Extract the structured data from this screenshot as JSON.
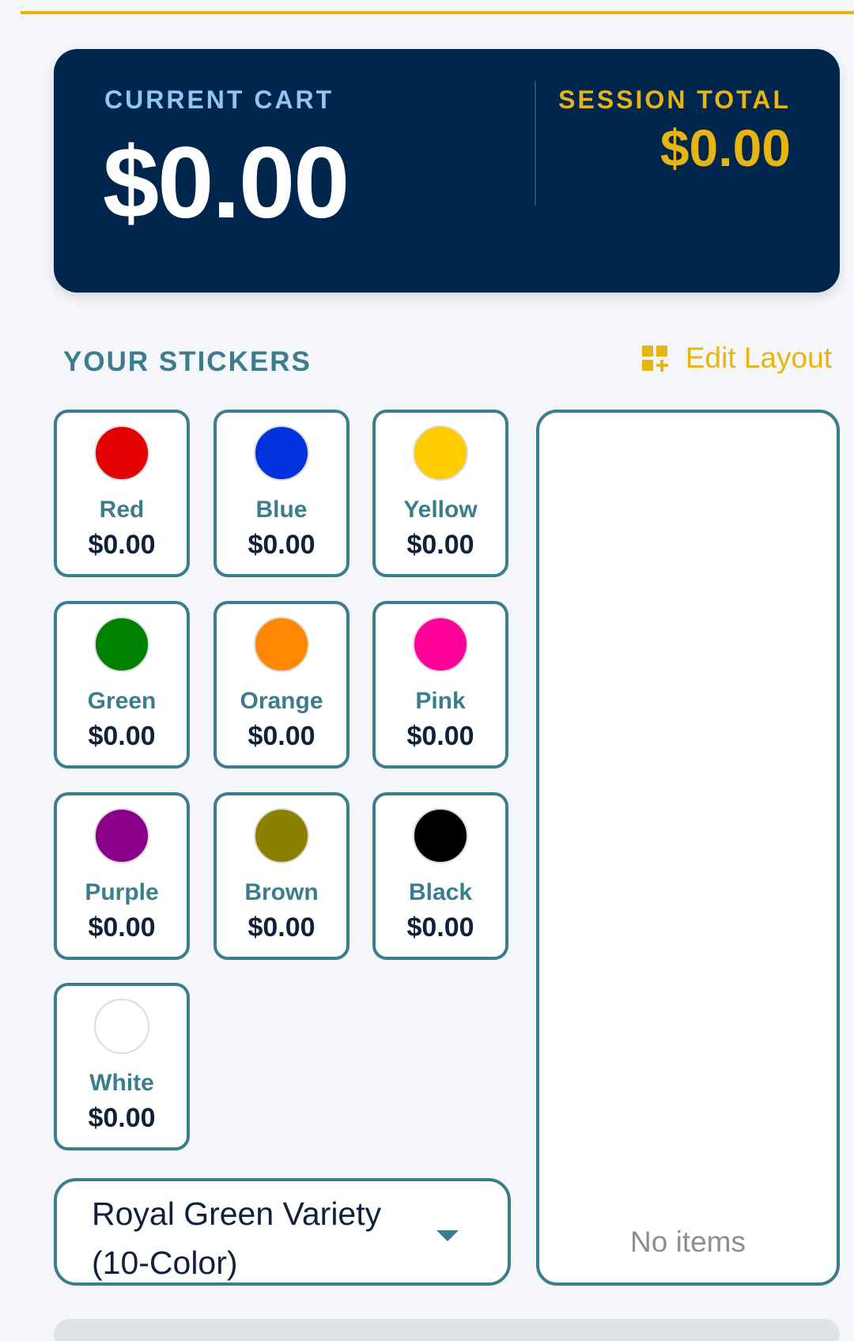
{
  "summary": {
    "current_cart_label": "CURRENT CART",
    "current_cart_amount": "$0.00",
    "session_total_label": "SESSION TOTAL",
    "session_total_amount": "$0.00"
  },
  "stickers_section": {
    "title": "YOUR STICKERS",
    "edit_layout_label": "Edit Layout",
    "edit_layout_icon": "dashboard-add-icon"
  },
  "stickers": [
    {
      "name": "Red",
      "price": "$0.00",
      "color": "#e30000"
    },
    {
      "name": "Blue",
      "price": "$0.00",
      "color": "#0033dd"
    },
    {
      "name": "Yellow",
      "price": "$0.00",
      "color": "#ffcc00"
    },
    {
      "name": "Green",
      "price": "$0.00",
      "color": "#008000"
    },
    {
      "name": "Orange",
      "price": "$0.00",
      "color": "#ff8800"
    },
    {
      "name": "Pink",
      "price": "$0.00",
      "color": "#ff0099"
    },
    {
      "name": "Purple",
      "price": "$0.00",
      "color": "#8b008b"
    },
    {
      "name": "Brown",
      "price": "$0.00",
      "color": "#8b8000"
    },
    {
      "name": "Black",
      "price": "$0.00",
      "color": "#000000"
    },
    {
      "name": "White",
      "price": "$0.00",
      "color": "#ffffff"
    }
  ],
  "variety_select": {
    "value": "Royal Green Variety (10-Color)"
  },
  "items_panel": {
    "empty_text": "No items"
  },
  "colors": {
    "navy": "#00264d",
    "gold": "#e6b512",
    "teal": "#3b7d8c"
  }
}
